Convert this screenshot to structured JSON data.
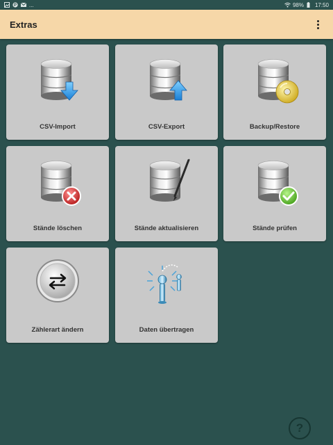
{
  "status_bar": {
    "left_icons": [
      "image-icon",
      "pinterest-icon",
      "mail-icon"
    ],
    "more": "...",
    "battery": "98%",
    "time": "17:50"
  },
  "app_bar": {
    "title": "Extras"
  },
  "tiles": [
    {
      "label": "CSV-Import",
      "icon": "database-import-icon"
    },
    {
      "label": "CSV-Export",
      "icon": "database-export-icon"
    },
    {
      "label": "Backup/Restore",
      "icon": "database-backup-icon"
    },
    {
      "label": "Stände löschen",
      "icon": "database-delete-icon"
    },
    {
      "label": "Stände aktualisieren",
      "icon": "database-edit-icon"
    },
    {
      "label": "Stände prüfen",
      "icon": "database-check-icon"
    },
    {
      "label": "Zählerart ändern",
      "icon": "switch-arrows-icon"
    },
    {
      "label": "Daten übertragen",
      "icon": "transfer-icon"
    }
  ],
  "help": {
    "label": "?"
  },
  "colors": {
    "background": "#2b514e",
    "app_bar": "#f6d7a8",
    "tile": "#c9c9c9"
  }
}
